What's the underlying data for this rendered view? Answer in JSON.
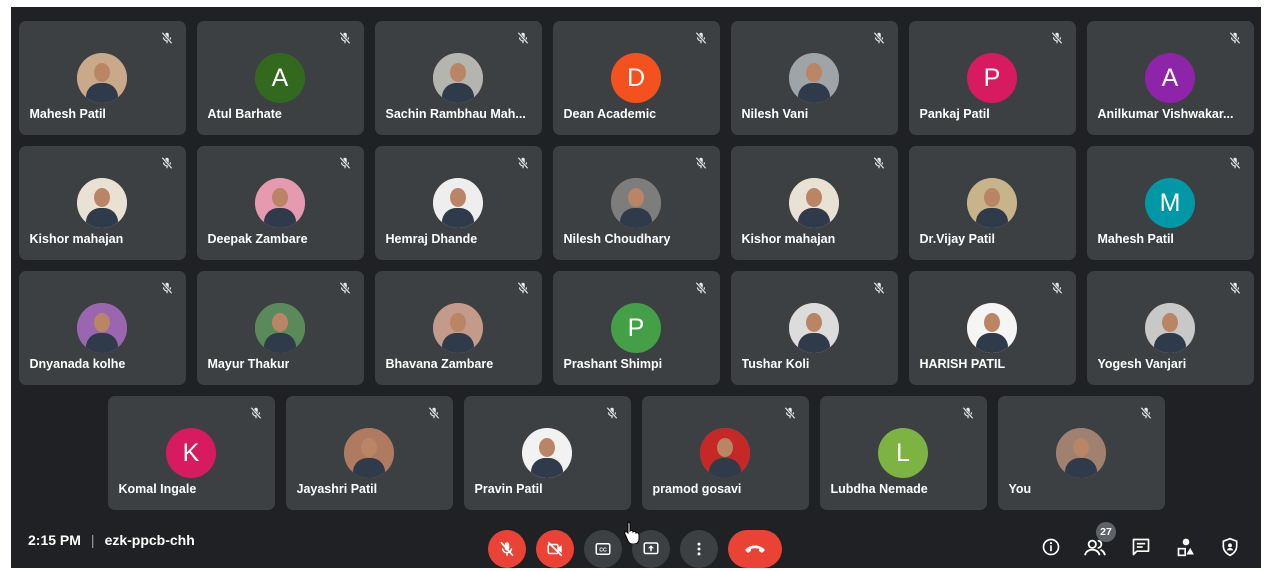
{
  "colors": {
    "background": "#202124",
    "tile": "#3c4043",
    "danger": "#ea4335",
    "control_dark": "#3c4043",
    "badge": "#5f6368",
    "text": "#ffffff"
  },
  "participants": {
    "row1": [
      {
        "name": "Mahesh Patil",
        "avatar": "photo",
        "bg": "#c9a98a",
        "muted": true
      },
      {
        "name": "Atul Barhate",
        "avatar": "letter",
        "letter": "A",
        "bg": "#33691e",
        "muted": true
      },
      {
        "name": "Sachin Rambhau Mah...",
        "avatar": "photo",
        "bg": "#b5b5b0",
        "muted": true
      },
      {
        "name": "Dean Academic",
        "avatar": "letter",
        "letter": "D",
        "bg": "#f4511e",
        "muted": true
      },
      {
        "name": "Nilesh Vani",
        "avatar": "photo",
        "bg": "#9fa4a8",
        "muted": true
      },
      {
        "name": "Pankaj Patil",
        "avatar": "letter",
        "letter": "P",
        "bg": "#d81b60",
        "muted": true
      },
      {
        "name": "Anilkumar Vishwakar...",
        "avatar": "letter",
        "letter": "A",
        "bg": "#8e24aa",
        "muted": true
      }
    ],
    "row2": [
      {
        "name": "Kishor mahajan",
        "avatar": "photo",
        "bg": "#e9e2d4",
        "muted": true
      },
      {
        "name": "Deepak Zambare",
        "avatar": "photo",
        "bg": "#e59ab0",
        "muted": true
      },
      {
        "name": "Hemraj Dhande",
        "avatar": "photo",
        "bg": "#eeeeee",
        "muted": true
      },
      {
        "name": "Nilesh Choudhary",
        "avatar": "photo",
        "bg": "#7d7d7d",
        "muted": true
      },
      {
        "name": "Kishor mahajan",
        "avatar": "photo",
        "bg": "#e9e2d4",
        "muted": true
      },
      {
        "name": "Dr.Vijay Patil",
        "avatar": "photo",
        "bg": "#c8b48a",
        "muted": false
      },
      {
        "name": "Mahesh Patil",
        "avatar": "letter",
        "letter": "M",
        "bg": "#0097a7",
        "muted": true
      }
    ],
    "row3": [
      {
        "name": "Dnyanada kolhe",
        "avatar": "photo",
        "bg": "#9a66b0",
        "muted": true
      },
      {
        "name": "Mayur Thakur",
        "avatar": "photo",
        "bg": "#5a8a5a",
        "muted": true
      },
      {
        "name": "Bhavana Zambare",
        "avatar": "photo",
        "bg": "#c49a8a",
        "muted": true
      },
      {
        "name": "Prashant Shimpi",
        "avatar": "letter",
        "letter": "P",
        "bg": "#43a047",
        "muted": true
      },
      {
        "name": "Tushar Koli",
        "avatar": "photo",
        "bg": "#dcdcdc",
        "muted": true
      },
      {
        "name": "HARISH PATIL",
        "avatar": "photo",
        "bg": "#f5f5f5",
        "muted": true
      },
      {
        "name": "Yogesh Vanjari",
        "avatar": "photo",
        "bg": "#c8c8c8",
        "muted": true
      }
    ],
    "row4": [
      {
        "name": "Komal Ingale",
        "avatar": "letter",
        "letter": "K",
        "bg": "#d81b60",
        "muted": true
      },
      {
        "name": "Jayashri Patil",
        "avatar": "photo",
        "bg": "#b07a60",
        "muted": true
      },
      {
        "name": "Pravin Patil",
        "avatar": "photo",
        "bg": "#f2f2f2",
        "muted": true
      },
      {
        "name": "pramod gosavi",
        "avatar": "photo",
        "bg": "#c62828",
        "muted": true
      },
      {
        "name": "Lubdha Nemade",
        "avatar": "letter",
        "letter": "L",
        "bg": "#7cb342",
        "muted": true
      },
      {
        "name": "You",
        "avatar": "photo",
        "bg": "#a08070",
        "muted": true
      }
    ]
  },
  "bottom_bar": {
    "time": "2:15 PM",
    "separator": "|",
    "meeting_code": "ezk-ppcb-chh",
    "participant_count": "27",
    "controls": [
      "mic-off-icon",
      "camera-off-icon",
      "captions-icon",
      "present-screen-icon",
      "more-options-icon",
      "end-call-icon"
    ],
    "right_icons": [
      "info-icon",
      "people-icon",
      "chat-icon",
      "activities-icon",
      "host-controls-icon"
    ]
  }
}
